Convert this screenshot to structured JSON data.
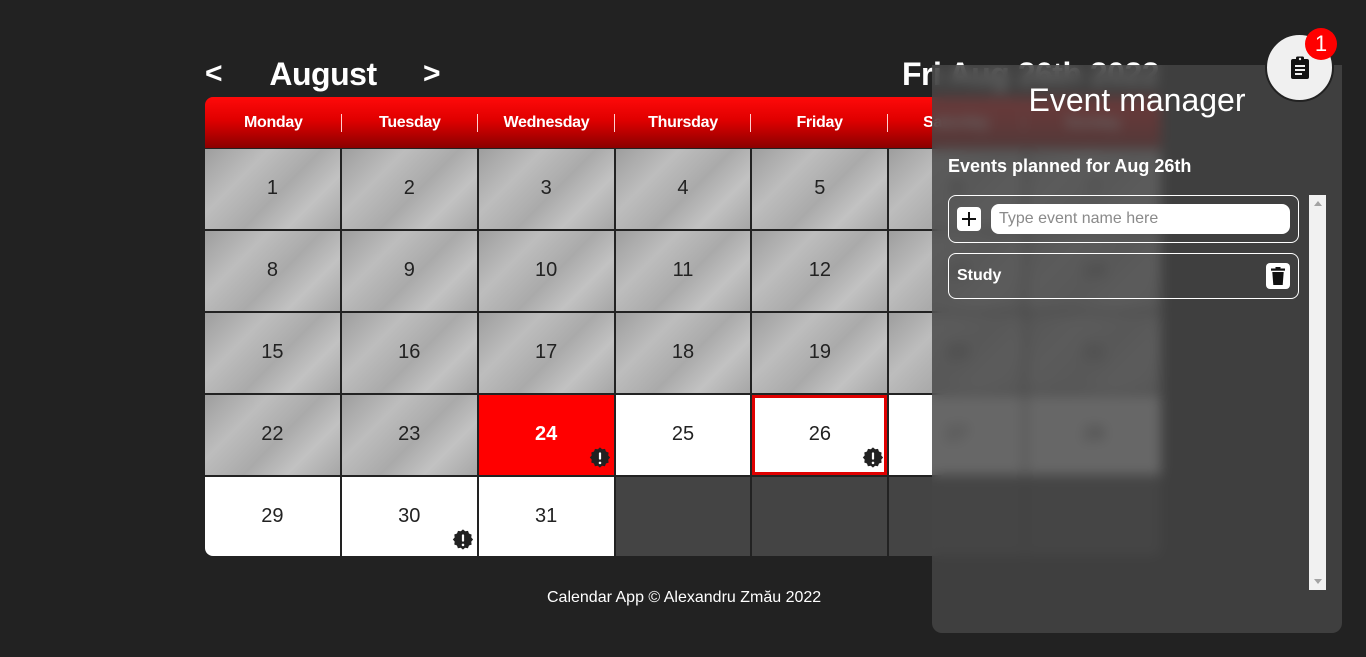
{
  "header": {
    "prev_label": "<",
    "next_label": ">",
    "month": "August",
    "selected_date": "Fri Aug 26th 2022"
  },
  "calendar": {
    "weekdays": [
      "Monday",
      "Tuesday",
      "Wednesday",
      "Thursday",
      "Friday",
      "Saturday",
      "Sunday"
    ],
    "days": [
      {
        "n": "1",
        "state": "past"
      },
      {
        "n": "2",
        "state": "past"
      },
      {
        "n": "3",
        "state": "past"
      },
      {
        "n": "4",
        "state": "past"
      },
      {
        "n": "5",
        "state": "past"
      },
      {
        "n": "6",
        "state": "past"
      },
      {
        "n": "7",
        "state": "past"
      },
      {
        "n": "8",
        "state": "past"
      },
      {
        "n": "9",
        "state": "past"
      },
      {
        "n": "10",
        "state": "past"
      },
      {
        "n": "11",
        "state": "past"
      },
      {
        "n": "12",
        "state": "past"
      },
      {
        "n": "13",
        "state": "past"
      },
      {
        "n": "14",
        "state": "past"
      },
      {
        "n": "15",
        "state": "past"
      },
      {
        "n": "16",
        "state": "past"
      },
      {
        "n": "17",
        "state": "past"
      },
      {
        "n": "18",
        "state": "past"
      },
      {
        "n": "19",
        "state": "past"
      },
      {
        "n": "20",
        "state": "past"
      },
      {
        "n": "21",
        "state": "past"
      },
      {
        "n": "22",
        "state": "past"
      },
      {
        "n": "23",
        "state": "past"
      },
      {
        "n": "24",
        "state": "today",
        "event": true
      },
      {
        "n": "25",
        "state": "future"
      },
      {
        "n": "26",
        "state": "selected",
        "event": true
      },
      {
        "n": "27",
        "state": "future"
      },
      {
        "n": "28",
        "state": "future"
      },
      {
        "n": "29",
        "state": "future"
      },
      {
        "n": "30",
        "state": "future",
        "event": true
      },
      {
        "n": "31",
        "state": "future"
      },
      {
        "n": "",
        "state": "empty"
      },
      {
        "n": "",
        "state": "empty"
      },
      {
        "n": "",
        "state": "empty"
      },
      {
        "n": "",
        "state": "empty"
      }
    ]
  },
  "footer": {
    "text": "Calendar App © Alexandru Zmău 2022"
  },
  "event_manager": {
    "title": "Event manager",
    "subtitle": "Events planned for Aug 26th",
    "input_placeholder": "Type event name here",
    "input_value": "",
    "events": [
      "Study"
    ],
    "toggle_icon": "clipboard-icon",
    "notification_count": "1"
  },
  "colors": {
    "accent": "#ff0000",
    "background": "#222222",
    "panel": "#464646"
  }
}
